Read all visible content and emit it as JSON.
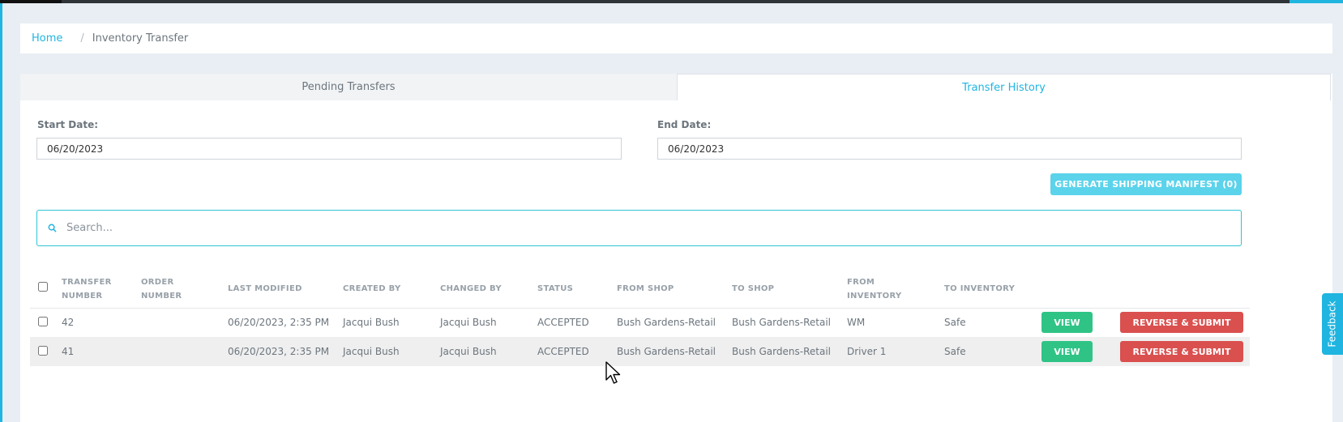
{
  "breadcrumb": {
    "home": "Home",
    "separator": "/",
    "current": "Inventory Transfer"
  },
  "tabs": [
    {
      "label": "Pending Transfers",
      "active": false
    },
    {
      "label": "Transfer History",
      "active": true
    }
  ],
  "filters": {
    "start_label": "Start Date:",
    "start_value": "06/20/2023",
    "end_label": "End Date:",
    "end_value": "06/20/2023"
  },
  "manifest_button": "GENERATE SHIPPING MANIFEST (0)",
  "search": {
    "placeholder": "Search...",
    "icon": "search-icon"
  },
  "table": {
    "headers": [
      "TRANSFER NUMBER",
      "ORDER NUMBER",
      "LAST MODIFIED",
      "CREATED BY",
      "CHANGED BY",
      "STATUS",
      "FROM SHOP",
      "TO SHOP",
      "FROM INVENTORY",
      "TO INVENTORY"
    ],
    "header_lines": {
      "transfer": [
        "TRANSFER",
        "NUMBER"
      ],
      "order": [
        "ORDER",
        "NUMBER"
      ],
      "from_inventory": [
        "FROM",
        "INVENTORY"
      ]
    },
    "rows": [
      {
        "transfer_number": "42",
        "order_number": "",
        "last_modified": "06/20/2023, 2:35 PM",
        "created_by": "Jacqui Bush",
        "changed_by": "Jacqui Bush",
        "status": "ACCEPTED",
        "from_shop": "Bush Gardens-Retail",
        "to_shop": "Bush Gardens-Retail",
        "from_inventory": "WM",
        "to_inventory": "Safe"
      },
      {
        "transfer_number": "41",
        "order_number": "",
        "last_modified": "06/20/2023, 2:35 PM",
        "created_by": "Jacqui Bush",
        "changed_by": "Jacqui Bush",
        "status": "ACCEPTED",
        "from_shop": "Bush Gardens-Retail",
        "to_shop": "Bush Gardens-Retail",
        "from_inventory": "Driver 1",
        "to_inventory": "Safe"
      }
    ],
    "view_label": "VIEW",
    "reverse_label": "REVERSE & SUBMIT"
  },
  "feedback_label": "Feedback",
  "colors": {
    "accent": "#1fb5e0",
    "view": "#2fc486",
    "reverse": "#d9504f",
    "manifest": "#5bd3eb"
  }
}
